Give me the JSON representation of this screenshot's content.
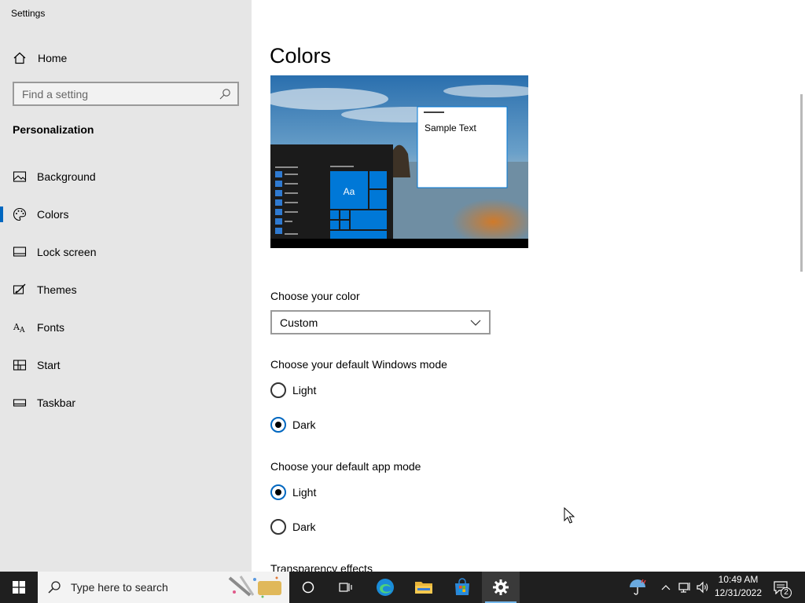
{
  "window": {
    "title": "Settings"
  },
  "sidebar": {
    "home_label": "Home",
    "search_placeholder": "Find a setting",
    "section_title": "Personalization",
    "items": [
      {
        "label": "Background",
        "icon": "image-icon",
        "active": false
      },
      {
        "label": "Colors",
        "icon": "palette-icon",
        "active": true
      },
      {
        "label": "Lock screen",
        "icon": "lock-screen-icon",
        "active": false
      },
      {
        "label": "Themes",
        "icon": "themes-icon",
        "active": false
      },
      {
        "label": "Fonts",
        "icon": "fonts-icon",
        "active": false
      },
      {
        "label": "Start",
        "icon": "start-icon",
        "active": false
      },
      {
        "label": "Taskbar",
        "icon": "taskbar-icon",
        "active": false
      }
    ]
  },
  "main": {
    "title": "Colors",
    "preview": {
      "sample_text": "Sample Text",
      "tile_label": "Aa"
    },
    "choose_color": {
      "label": "Choose your color",
      "value": "Custom"
    },
    "windows_mode": {
      "label": "Choose your default Windows mode",
      "options": [
        {
          "label": "Light",
          "checked": false
        },
        {
          "label": "Dark",
          "checked": true
        }
      ]
    },
    "app_mode": {
      "label": "Choose your default app mode",
      "options": [
        {
          "label": "Light",
          "checked": true
        },
        {
          "label": "Dark",
          "checked": false
        }
      ]
    },
    "transparency_label": "Transparency effects"
  },
  "taskbar": {
    "search_placeholder": "Type here to search",
    "apps": [
      "task-view-icon",
      "edge-icon",
      "file-explorer-icon",
      "microsoft-store-icon",
      "settings-gear-icon"
    ],
    "time": "10:49 AM",
    "date": "12/31/2022",
    "notification_count": "2"
  },
  "colors": {
    "accent": "#0067c0",
    "sidebar_bg": "#e6e6e6",
    "taskbar_bg": "#1f1f1f",
    "tile_blue": "#0078d7"
  }
}
